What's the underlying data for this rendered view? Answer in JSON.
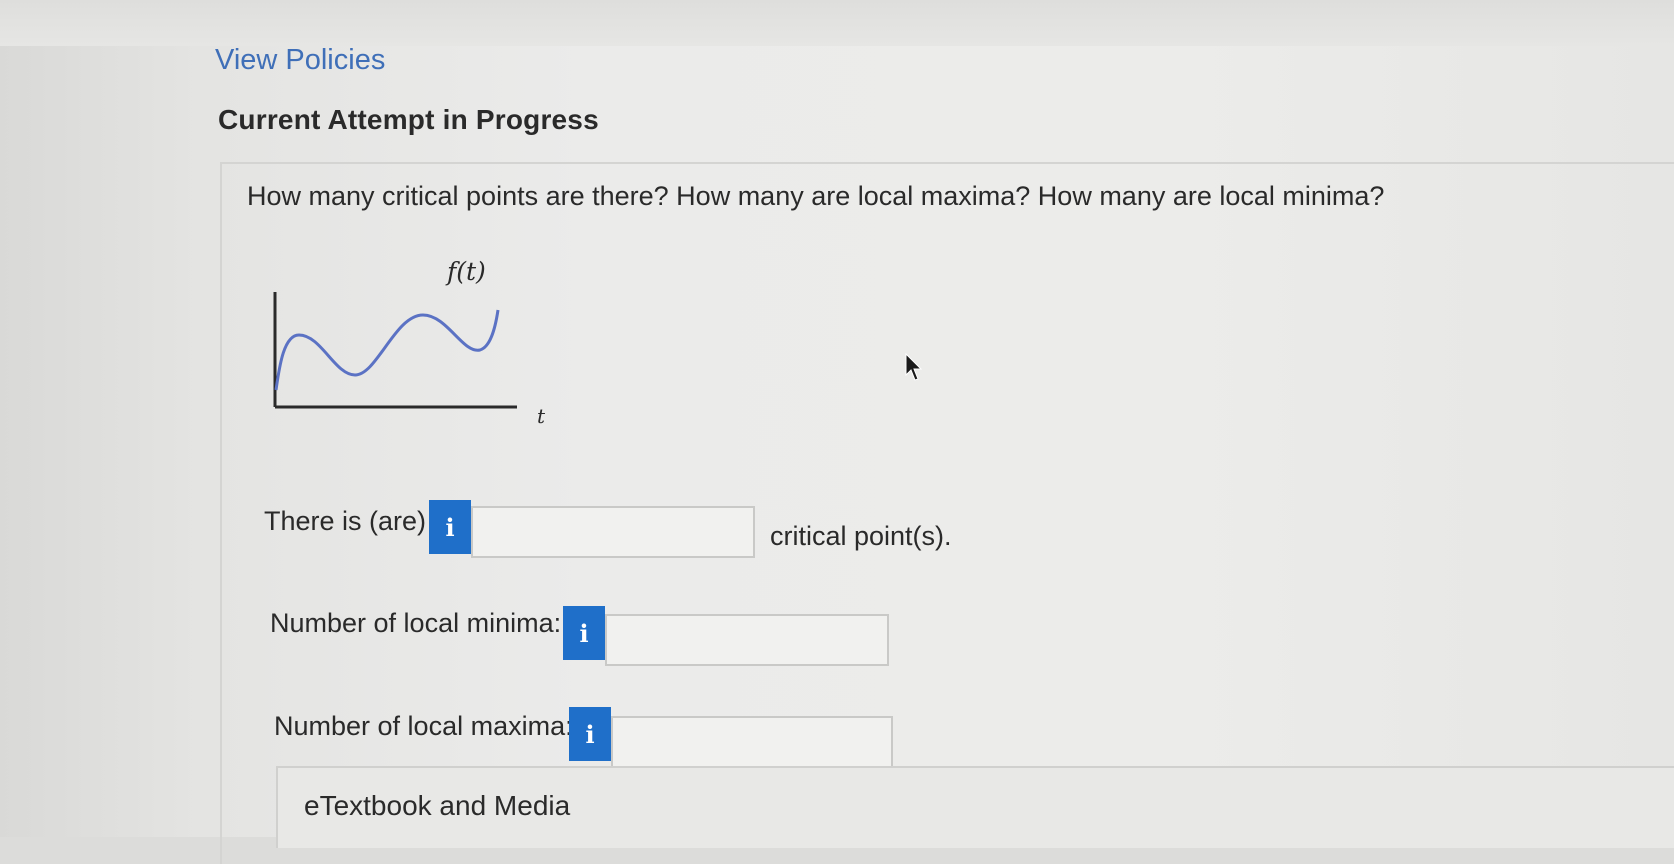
{
  "policies_link": "View Policies",
  "attempt_heading": "Current Attempt in Progress",
  "question": "How many critical points are there? How many are local maxima? How many are local minima?",
  "graph": {
    "y_label": "f(t)",
    "x_label": "t",
    "curve_color": "#5b72c4",
    "axis_color": "#2a2a2a"
  },
  "rows": {
    "critical": {
      "prefix": "There is (are)",
      "suffix": "critical point(s).",
      "info_icon": "i",
      "value": ""
    },
    "minima": {
      "label": "Number of local minima:",
      "info_icon": "i",
      "value": ""
    },
    "maxima": {
      "label": "Number of local maxima:",
      "info_icon": "i",
      "value": ""
    }
  },
  "etextbook_label": "eTextbook and Media",
  "colors": {
    "link": "#3f6fb8",
    "info_button": "#1f6fc9"
  }
}
